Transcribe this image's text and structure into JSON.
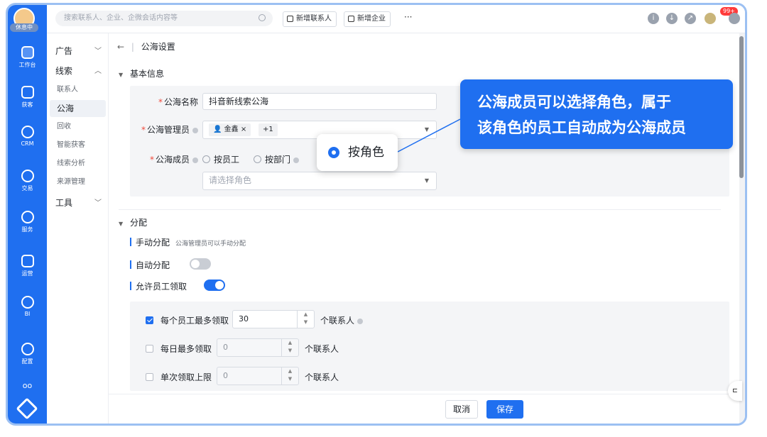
{
  "rail": {
    "status": "休息中",
    "items": [
      {
        "label": "工作台",
        "icon": "workbench-icon"
      },
      {
        "label": "获客",
        "icon": "acquire-icon"
      },
      {
        "label": "CRM",
        "icon": "crm-icon"
      },
      {
        "label": "交易",
        "icon": "yen-icon"
      },
      {
        "label": "服务",
        "icon": "phone-icon"
      },
      {
        "label": "运营",
        "icon": "chart-icon"
      },
      {
        "label": "BI",
        "icon": "pie-icon"
      },
      {
        "label": "配置",
        "icon": "gear-icon"
      }
    ],
    "more": "oo"
  },
  "topbar": {
    "search_placeholder": "搜索联系人、企业、企微会话内容等",
    "add_contact": "新增联系人",
    "add_company": "新增企业",
    "more": "···",
    "badge": "99+"
  },
  "subnav": {
    "group_ads": "广告",
    "group_leads": "线索",
    "items": [
      "联系人",
      "公海",
      "回收",
      "智能获客",
      "线索分析",
      "来源管理"
    ],
    "group_tools": "工具"
  },
  "breadcrumb": {
    "back": "←",
    "title": "公海设置"
  },
  "basic": {
    "heading": "基本信息",
    "name_label": "公海名称",
    "name_value": "抖音新线索公海",
    "admin_label": "公海管理员",
    "admin_tag": "金鑫",
    "admin_more": "+1",
    "member_label": "公海成员",
    "opt_employee": "按员工",
    "opt_dept": "按部门",
    "role_placeholder": "请选择角色"
  },
  "assign": {
    "heading": "分配",
    "manual_label": "手动分配",
    "manual_hint": "公海管理员可以手动分配",
    "auto_label": "自动分配",
    "claim_label": "允许员工领取",
    "rule1_label": "每个员工最多领取",
    "rule1_value": "30",
    "rule2_label": "每日最多领取",
    "rule2_value": "0",
    "rule3_label": "单次领取上限",
    "rule3_value": "0",
    "unit": "个联系人"
  },
  "footer": {
    "cancel": "取消",
    "save": "保存"
  },
  "callouts": {
    "line1": "公海成员可以选择角色，属于",
    "line2": "该角色的员工自动成为公海成员",
    "chip": "按角色"
  },
  "colors": {
    "accent": "#1f6ff0",
    "required": "#f04a3c"
  }
}
